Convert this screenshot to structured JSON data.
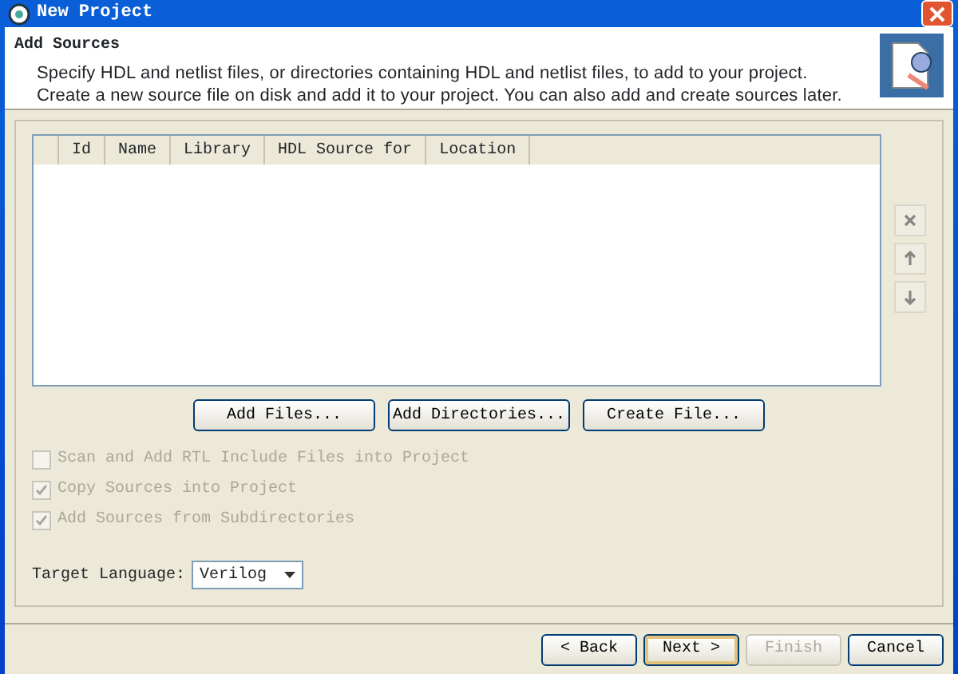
{
  "window": {
    "title": "New Project"
  },
  "header": {
    "title": "Add Sources",
    "description": [
      "Specify HDL and netlist files, or directories containing HDL and netlist files, to add to your project.",
      "Create a new source file on disk and add it to your project. You can also add and create sources later."
    ]
  },
  "table": {
    "columns": [
      "Id",
      "Name",
      "Library",
      "HDL Source for",
      "Location"
    ]
  },
  "side_buttons": [
    {
      "kind": "remove",
      "disabled": true
    },
    {
      "kind": "up",
      "disabled": true
    },
    {
      "kind": "down",
      "disabled": true
    }
  ],
  "add_buttons": [
    "Add Files...",
    "Add Directories...",
    "Create File..."
  ],
  "options": [
    {
      "label": "Scan and Add RTL Include Files into Project",
      "checked": false,
      "disabled": true
    },
    {
      "label": "Copy Sources into Project",
      "checked": true,
      "disabled": true
    },
    {
      "label": "Add Sources from Subdirectories",
      "checked": true,
      "disabled": true
    }
  ],
  "target_language": {
    "label": "Target Language:",
    "value": "Verilog"
  },
  "footer_buttons": [
    {
      "label": "< Back",
      "disabled": false,
      "default": false
    },
    {
      "label": "Next >",
      "disabled": false,
      "default": true
    },
    {
      "label": "Finish",
      "disabled": true,
      "default": false
    },
    {
      "label": "Cancel",
      "disabled": false,
      "default": false
    }
  ]
}
